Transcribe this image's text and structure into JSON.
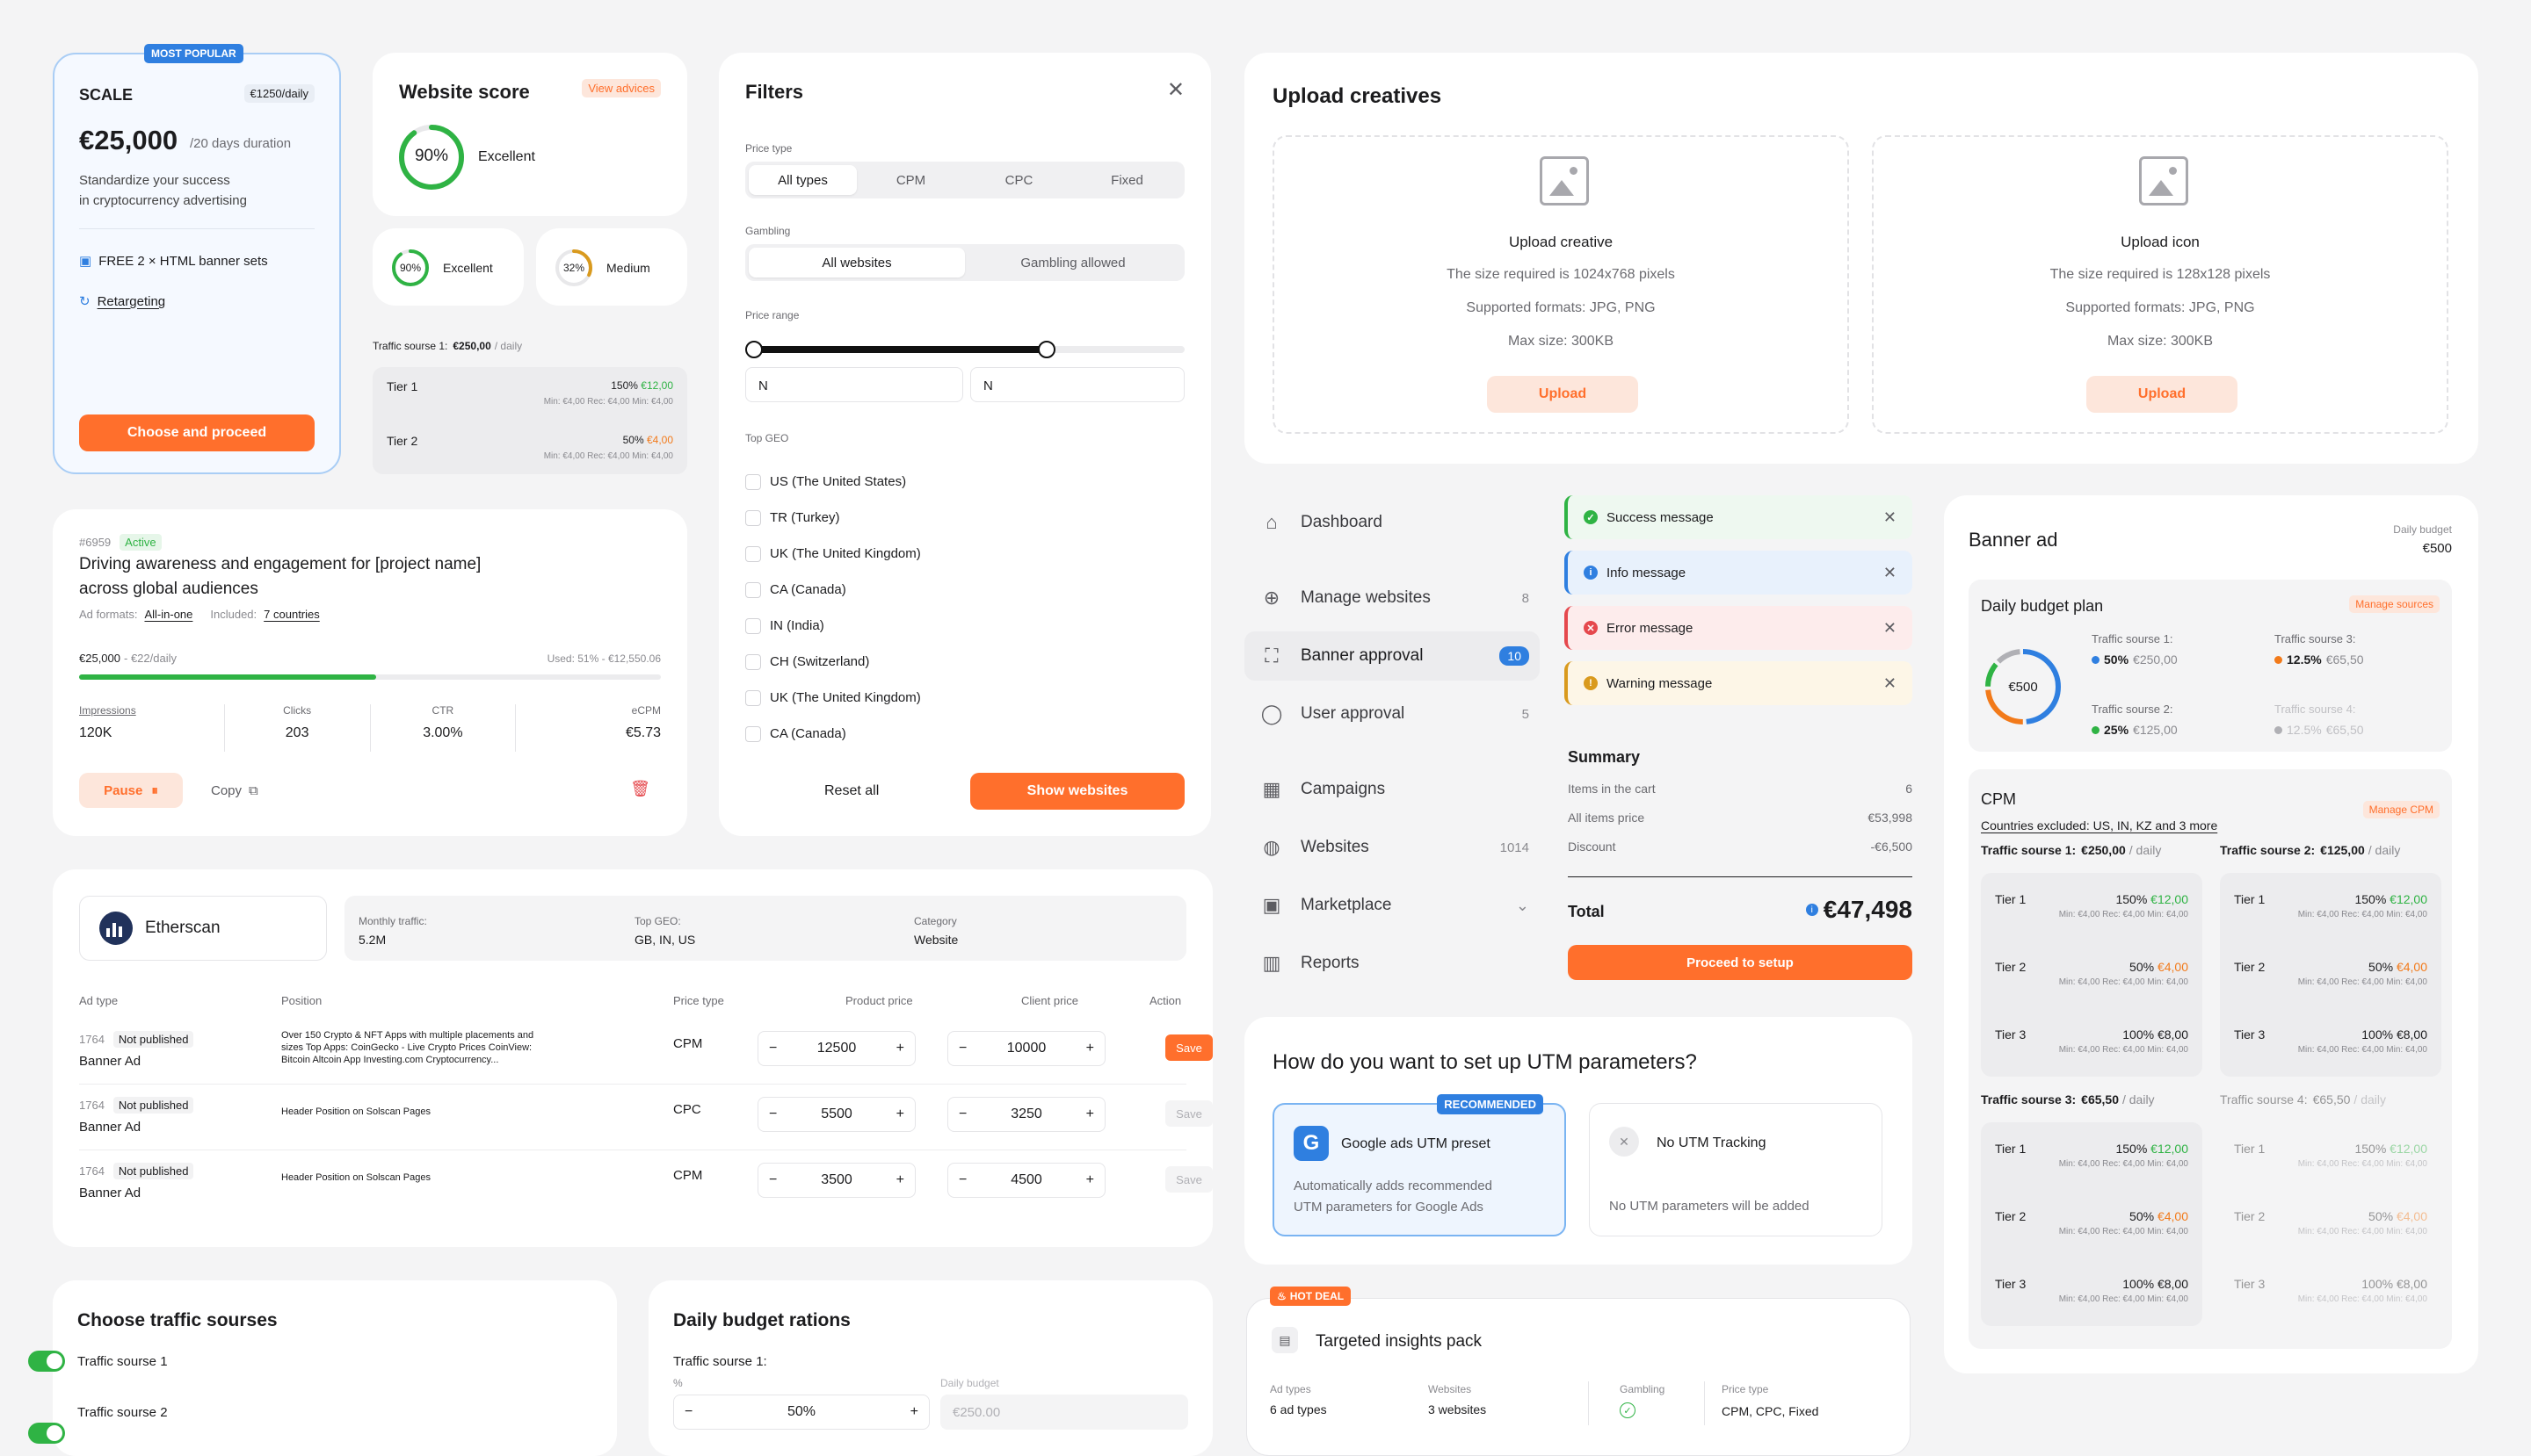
{
  "scale": {
    "badge": "MOST POPULAR",
    "title": "SCALE",
    "daily_chip": "€1250/daily",
    "price": "€25,000",
    "duration": "/20 days duration",
    "desc1": "Standardize your success",
    "desc2": "in cryptocurrency advertising",
    "feature1": "FREE 2 × HTML banner sets",
    "feature2": "Retargeting",
    "cta": "Choose and proceed"
  },
  "score": {
    "title": "Website score",
    "advice": "View advices",
    "big": "90%",
    "big_label": "Excellent",
    "small1": "90%",
    "small1_label": "Excellent",
    "small2": "32%",
    "small2_label": "Medium",
    "big_value": 0.9,
    "small1_value": 0.9,
    "small2_value": 0.32
  },
  "tiers_left": {
    "label": "Traffic sourse 1:",
    "amount": "€250,00",
    "unit": "/ daily",
    "tiers": [
      {
        "name": "Tier 1",
        "pct": "150%",
        "price": "€12,00",
        "mins": "Min: €4,00   Rec: €4,00   Min: €4,00"
      },
      {
        "name": "Tier 2",
        "pct": "50%",
        "price": "€4,00",
        "mins": "Min: €4,00   Rec: €4,00   Min: €4,00"
      }
    ]
  },
  "filters": {
    "title": "Filters",
    "price_type_label": "Price type",
    "price_types": [
      "All types",
      "CPM",
      "CPC",
      "Fixed"
    ],
    "gambling_label": "Gambling",
    "gambling_opts": [
      "All websites",
      "Gambling allowed"
    ],
    "range_label": "Price range",
    "range_min": "N",
    "range_max": "N",
    "range_fill": 0.68,
    "geo_label": "Top GEO",
    "geos": [
      "US (The United States)",
      "TR (Turkey)",
      "UK (The United Kingdom)",
      "CA (Canada)",
      "IN (India)",
      "CH (Switzerland)",
      "UK (The United Kingdom)",
      "CA (Canada)"
    ],
    "reset": "Reset all",
    "show": "Show websites"
  },
  "campaign": {
    "id": "#6959",
    "status": "Active",
    "title1": "Driving awareness and engagement for [project name]",
    "title2": "across global audiences",
    "formats_label": "Ad formats:",
    "formats": "All-in-one",
    "included_label": "Included:",
    "included": "7 countries",
    "budget": "€25,000",
    "budget_daily": "- €22/daily",
    "used": "Used: 51% - €12,550.06",
    "used_value": 0.51,
    "stats": [
      {
        "label": "Impressions",
        "value": "120K"
      },
      {
        "label": "Clicks",
        "value": "203"
      },
      {
        "label": "CTR",
        "value": "3.00%"
      },
      {
        "label": "eCPM",
        "value": "€5.73"
      }
    ],
    "pause": "Pause",
    "copy": "Copy"
  },
  "etherscan": {
    "name": "Etherscan",
    "traffic_label": "Monthly traffic:",
    "traffic": "5.2M",
    "geo_label": "Top GEO:",
    "geo": "GB, IN, US",
    "cat_label": "Category",
    "cat": "Website",
    "headers": [
      "Ad type",
      "Position",
      "Price type",
      "Product price",
      "Client price",
      "Action"
    ],
    "rows": [
      {
        "id": "1764",
        "status": "Not published",
        "type": "Banner Ad",
        "pos1": "Over 150 Crypto & NFT Apps with multiple placements and",
        "pos2": "sizes Top Apps: CoinGecko - Live Crypto Prices CoinView:",
        "pos3": "Bitcoin Altcoin App Investing.com Cryptocurrency...",
        "ptype": "CPM",
        "product": "12500",
        "client": "10000",
        "action": "Save"
      },
      {
        "id": "1764",
        "status": "Not published",
        "type": "Banner Ad",
        "pos1": "Header Position on Solscan Pages",
        "pos2": "",
        "pos3": "",
        "ptype": "CPC",
        "product": "5500",
        "client": "3250",
        "action": "Save"
      },
      {
        "id": "1764",
        "status": "Not published",
        "type": "Banner Ad",
        "pos1": "Header Position on Solscan Pages",
        "pos2": "",
        "pos3": "",
        "ptype": "CPM",
        "product": "3500",
        "client": "4500",
        "action": "Save"
      }
    ]
  },
  "traffic_sources": {
    "title": "Choose traffic sourses",
    "items": [
      "Traffic sourse 1",
      "Traffic sourse 2"
    ]
  },
  "rations": {
    "title": "Daily budget rations",
    "source": "Traffic sourse 1:",
    "pct_label": "%",
    "daily_label": "Daily budget",
    "pct_value": "50%",
    "daily_value": "€250.00"
  },
  "upload": {
    "title": "Upload creatives",
    "boxes": [
      {
        "title": "Upload creative",
        "size": "The size required is 1024x768 pixels",
        "formats": "Supported formats: JPG, PNG",
        "max": "Max size: 300KB",
        "btn": "Upload"
      },
      {
        "title": "Upload icon",
        "size": "The size required is 128x128 pixels",
        "formats": "Supported formats: JPG, PNG",
        "max": "Max size: 300KB",
        "btn": "Upload"
      }
    ]
  },
  "nav": {
    "items": [
      {
        "label": "Dashboard",
        "count": ""
      },
      {
        "label": "Manage websites",
        "count": "8"
      },
      {
        "label": "Banner approval",
        "count": "10"
      },
      {
        "label": "User approval",
        "count": "5"
      },
      {
        "label": "Campaigns",
        "count": ""
      },
      {
        "label": "Websites",
        "count": "1014"
      },
      {
        "label": "Marketplace",
        "count": ""
      },
      {
        "label": "Reports",
        "count": ""
      }
    ]
  },
  "toasts": [
    {
      "text": "Success message",
      "color": "#2fb344"
    },
    {
      "text": "Info message",
      "color": "#2f7fe0"
    },
    {
      "text": "Error message",
      "color": "#e5484d"
    },
    {
      "text": "Warning message",
      "color": "#d99a1e"
    }
  ],
  "summary": {
    "title": "Summary",
    "rows": [
      {
        "label": "Items in the cart",
        "value": "6"
      },
      {
        "label": "All items price",
        "value": "€53,998"
      },
      {
        "label": "Discount",
        "value": "-€6,500"
      }
    ],
    "total_label": "Total",
    "total": "€47,498",
    "cta": "Proceed to setup"
  },
  "utm": {
    "title": "How do you want to set up UTM parameters?",
    "opt1": {
      "badge": "RECOMMENDED",
      "title": "Google ads UTM preset",
      "desc1": "Automatically adds recommended",
      "desc2": "UTM parameters for Google Ads"
    },
    "opt2": {
      "title": "No UTM Tracking",
      "desc": "No UTM parameters will be added"
    }
  },
  "deal": {
    "badge": "HOT DEAL",
    "title": "Targeted insights pack",
    "cols": [
      {
        "label": "Ad types",
        "value": "6 ad types"
      },
      {
        "label": "Websites",
        "value": "3 websites"
      },
      {
        "label": "Gambling",
        "value": ""
      },
      {
        "label": "Price type",
        "value": "CPM, CPC, Fixed"
      }
    ]
  },
  "banner": {
    "title": "Banner ad",
    "budget_label": "Daily budget",
    "budget": "€500",
    "plan_title": "Daily budget plan",
    "manage_sources": "Manage sources",
    "donut_label": "€500",
    "sources": [
      {
        "label": "Traffic sourse 1:",
        "pct": "50%",
        "amount": "€250,00",
        "color": "#2f7fe0"
      },
      {
        "label": "Traffic sourse 3:",
        "pct": "12.5%",
        "amount": "€65,50",
        "color": "#f27a1a"
      },
      {
        "label": "Traffic sourse 2:",
        "pct": "25%",
        "amount": "€125,00",
        "color": "#2fb344"
      },
      {
        "label": "Traffic sourse 4:",
        "pct": "12.5%",
        "amount": "€65,50",
        "color": "#b0b0b5"
      }
    ],
    "donut_values": [
      0.5,
      0.25,
      0.125,
      0.125
    ],
    "cpm_title": "CPM",
    "manage_cpm": "Manage CPM",
    "excluded": "Countries excluded: US, IN, KZ and 3 more",
    "groups": [
      {
        "label": "Traffic sourse 1:",
        "amount": "€250,00",
        "unit": "/ daily",
        "dim": false
      },
      {
        "label": "Traffic sourse 2:",
        "amount": "€125,00",
        "unit": "/ daily",
        "dim": false
      },
      {
        "label": "Traffic sourse 3:",
        "amount": "€65,50",
        "unit": "/ daily",
        "dim": false
      },
      {
        "label": "Traffic sourse 4:",
        "amount": "€65,50",
        "unit": "/ daily",
        "dim": true
      }
    ],
    "tiers": [
      {
        "name": "Tier 1",
        "pct": "150%",
        "price": "€12,00",
        "cls": "green"
      },
      {
        "name": "Tier 2",
        "pct": "50%",
        "price": "€4,00",
        "cls": "orange"
      },
      {
        "name": "Tier 3",
        "pct": "100%",
        "price": "€8,00",
        "cls": ""
      }
    ],
    "mins": "Min: €4,00   Rec: €4,00   Min: €4,00"
  }
}
